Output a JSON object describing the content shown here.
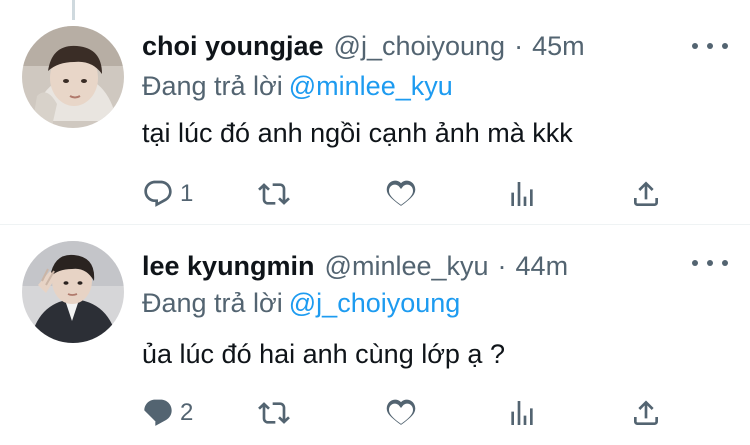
{
  "tweets": [
    {
      "display_name": "choi youngjae",
      "handle": "@j_choiyoung",
      "separator": "·",
      "time": "45m",
      "reply_prefix": "Đang trả lời",
      "reply_to": "@minlee_kyu",
      "text": "tại lúc đó anh ngồi cạnh ảnh mà kkk",
      "reply_count": "1",
      "retweet_count": "",
      "like_count": ""
    },
    {
      "display_name": "lee kyungmin",
      "handle": "@minlee_kyu",
      "separator": "·",
      "time": "44m",
      "reply_prefix": "Đang trả lời",
      "reply_to": "@j_choiyoung",
      "text": "ủa lúc đó hai anh cùng lớp ạ ?",
      "reply_count": "2",
      "retweet_count": "",
      "like_count": ""
    }
  ],
  "colors": {
    "text_primary": "#0f1419",
    "text_secondary": "#536471",
    "accent": "#1d9bf0",
    "thread_line": "#cfd9de"
  },
  "icons": [
    "reply-icon",
    "retweet-icon",
    "like-icon",
    "stats-icon",
    "share-icon",
    "more-icon"
  ]
}
